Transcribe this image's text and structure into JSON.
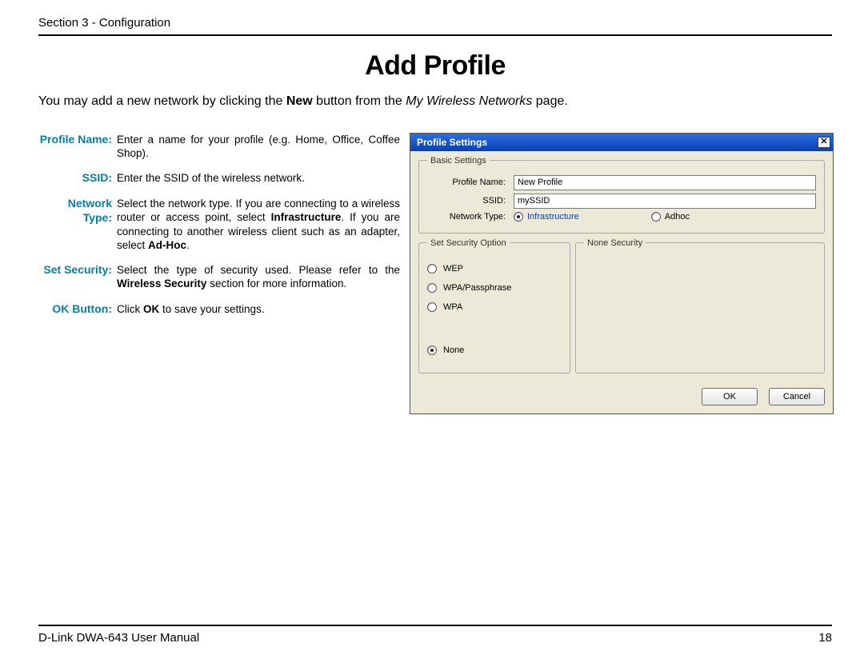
{
  "header": {
    "section": "Section 3 - Configuration"
  },
  "title": "Add Profile",
  "intro": {
    "pre": "You may add a new network by clicking the ",
    "bold1": "New",
    "mid": " button from the ",
    "ital": "My Wireless Networks",
    "post": " page."
  },
  "defs": [
    {
      "label": "Profile Name:",
      "kind": "plain",
      "text": "Enter a name for your profile (e.g. Home, Office, Coffee Shop)."
    },
    {
      "label": "SSID:",
      "kind": "plain",
      "text": "Enter the SSID of the wireless network."
    },
    {
      "label": "Network Type:",
      "kind": "nettype",
      "p1": "Select the network type. If you are connecting to a wireless router or access point, select ",
      "b1": "Infrastructure",
      "p2": ". If you are connecting to another wireless client such as an adapter, select ",
      "b2": "Ad-Hoc",
      "p3": "."
    },
    {
      "label": "Set Security:",
      "kind": "setsec",
      "p1": "Select the type of security used. Please refer to the ",
      "b1": "Wireless Security",
      "p2": " section for more information."
    },
    {
      "label": "OK Button:",
      "kind": "okbtn",
      "p1": "Click ",
      "b1": "OK",
      "p2": " to save your settings."
    }
  ],
  "dialog": {
    "title": "Profile Settings",
    "basic": {
      "legend": "Basic Settings",
      "profile_label": "Profile Name:",
      "profile_value": "New Profile",
      "ssid_label": "SSID:",
      "ssid_value": "mySSID",
      "nettype_label": "Network Type:",
      "nettype_opts": [
        "Infrastructure",
        "Adhoc"
      ],
      "nettype_selected": 0
    },
    "sec_left_legend": "Set Security Option",
    "sec_right_legend": "None Security",
    "sec_opts": [
      "WEP",
      "WPA/Passphrase",
      "WPA",
      "None"
    ],
    "sec_selected": 3,
    "ok": "OK",
    "cancel": "Cancel"
  },
  "footer": {
    "left": "D-Link DWA-643 User Manual",
    "right": "18"
  }
}
